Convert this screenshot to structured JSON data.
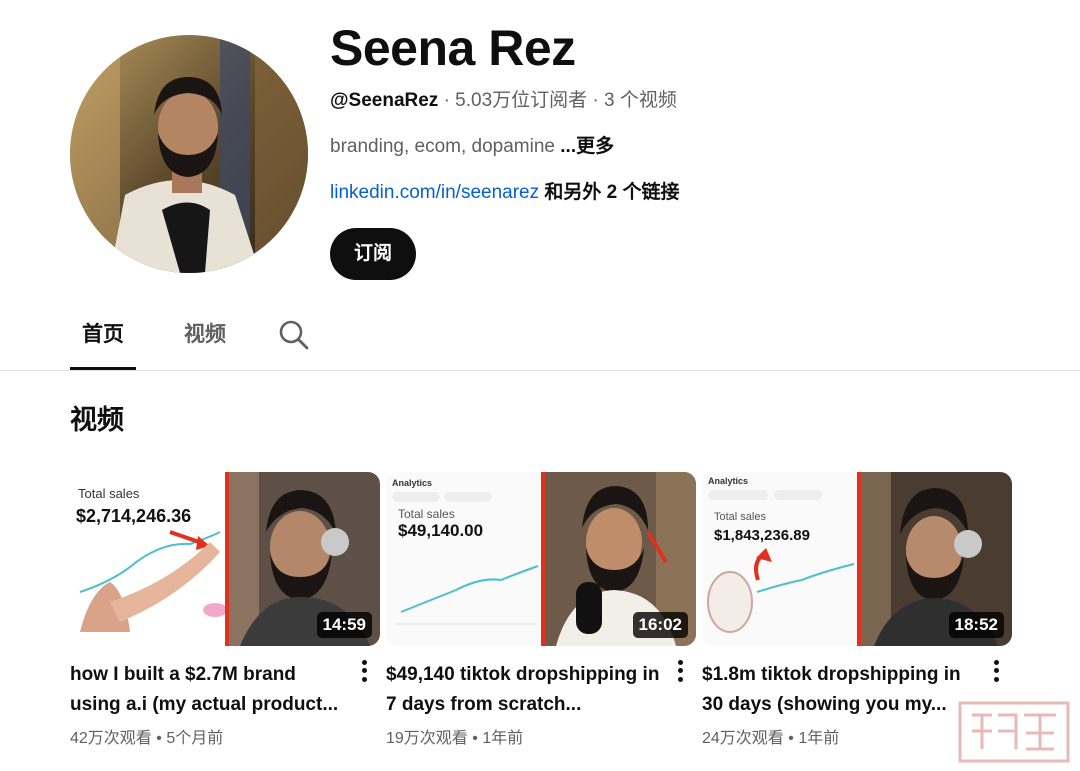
{
  "channel": {
    "name": "Seena Rez",
    "handle": "@SeenaRez",
    "stats": " · 5.03万位订阅者 · 3 个视频",
    "description": "branding, ecom, dopamine ",
    "more_label": "...更多",
    "link": "linkedin.com/in/seenarez",
    "other_links": " 和另外 2 个链接",
    "subscribe_label": "订阅"
  },
  "tabs": [
    {
      "label": "首页",
      "active": true
    },
    {
      "label": "视频",
      "active": false
    }
  ],
  "section_title": "视频",
  "videos": [
    {
      "title": "how I built a $2.7M brand using a.i (my actual product...",
      "duration": "14:59",
      "views": "42万次观看",
      "age": "5个月前",
      "overlay_label": "Total sales",
      "overlay_value": "$2,714,246.36"
    },
    {
      "title": "$49,140 tiktok dropshipping in 7 days from scratch...",
      "duration": "16:02",
      "views": "19万次观看",
      "age": "1年前",
      "overlay_header": "Analytics",
      "overlay_label": "Total sales",
      "overlay_value": "$49,140.00"
    },
    {
      "title": "$1.8m tiktok dropshipping in 30 days (showing you my...",
      "duration": "18:52",
      "views": "24万次观看",
      "age": "1年前",
      "overlay_header": "Analytics",
      "overlay_label": "Total sales",
      "overlay_value": "$1,843,236.89"
    }
  ],
  "icons": {
    "search": "search-icon",
    "more": "more-vert-icon"
  },
  "colors": {
    "accent_red": "#e0301e",
    "link_blue": "#065fd4",
    "text_primary": "#0f0f0f",
    "text_secondary": "#606060"
  }
}
